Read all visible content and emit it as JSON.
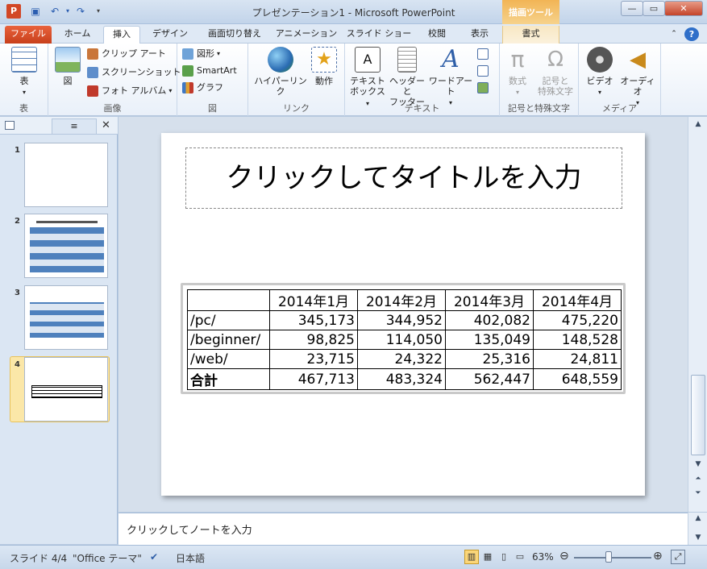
{
  "window": {
    "title": "プレゼンテーション1 - Microsoft PowerPoint",
    "context_tab_header": "描画ツール"
  },
  "tabs": [
    "ファイル",
    "ホーム",
    "挿入",
    "デザイン",
    "画面切り替え",
    "アニメーション",
    "スライド ショー",
    "校閲",
    "表示",
    "書式"
  ],
  "active_tab": "挿入",
  "ribbon": {
    "groups": {
      "table": "表",
      "images": "画像",
      "illustrations": "図",
      "links": "リンク",
      "text": "テキスト",
      "symbols": "記号と特殊文字",
      "media": "メディア"
    },
    "buttons": {
      "table": "表",
      "picture": "図",
      "clip_art": "クリップ アート",
      "screenshot": "スクリーンショット",
      "photo_album": "フォト アルバム",
      "shapes": "図形",
      "smartart": "SmartArt",
      "chart": "グラフ",
      "hyperlink": "ハイパーリンク",
      "action": "動作",
      "textbox_1": "テキスト",
      "textbox_2": "ボックス",
      "header_footer_1": "ヘッダーと",
      "header_footer_2": "フッター",
      "wordart": "ワードアート",
      "equation": "数式",
      "symbol_1": "記号と",
      "symbol_2": "特殊文字",
      "video": "ビデオ",
      "audio": "オーディオ"
    }
  },
  "thumbnails": [
    "1",
    "2",
    "3",
    "4"
  ],
  "slide": {
    "title_placeholder": "クリックしてタイトルを入力",
    "table": {
      "headers": [
        "",
        "2014年1月",
        "2014年2月",
        "2014年3月",
        "2014年4月"
      ],
      "rows": [
        [
          "/pc/",
          "345,173",
          "344,952",
          "402,082",
          "475,220"
        ],
        [
          "/beginner/",
          "98,825",
          "114,050",
          "135,049",
          "148,528"
        ],
        [
          "/web/",
          "23,715",
          "24,322",
          "25,316",
          "24,811"
        ],
        [
          "合計",
          "467,713",
          "483,324",
          "562,447",
          "648,559"
        ]
      ]
    }
  },
  "notes_placeholder": "クリックしてノートを入力",
  "status": {
    "slide": "スライド 4/4",
    "theme": "\"Office テーマ\"",
    "language": "日本語",
    "zoom": "63%",
    "zoom_fraction": 0.45
  },
  "colors": {
    "file_tab": "#d04a20",
    "context_tab": "#f2b455",
    "selected_thumb": "#fbe7a8"
  }
}
